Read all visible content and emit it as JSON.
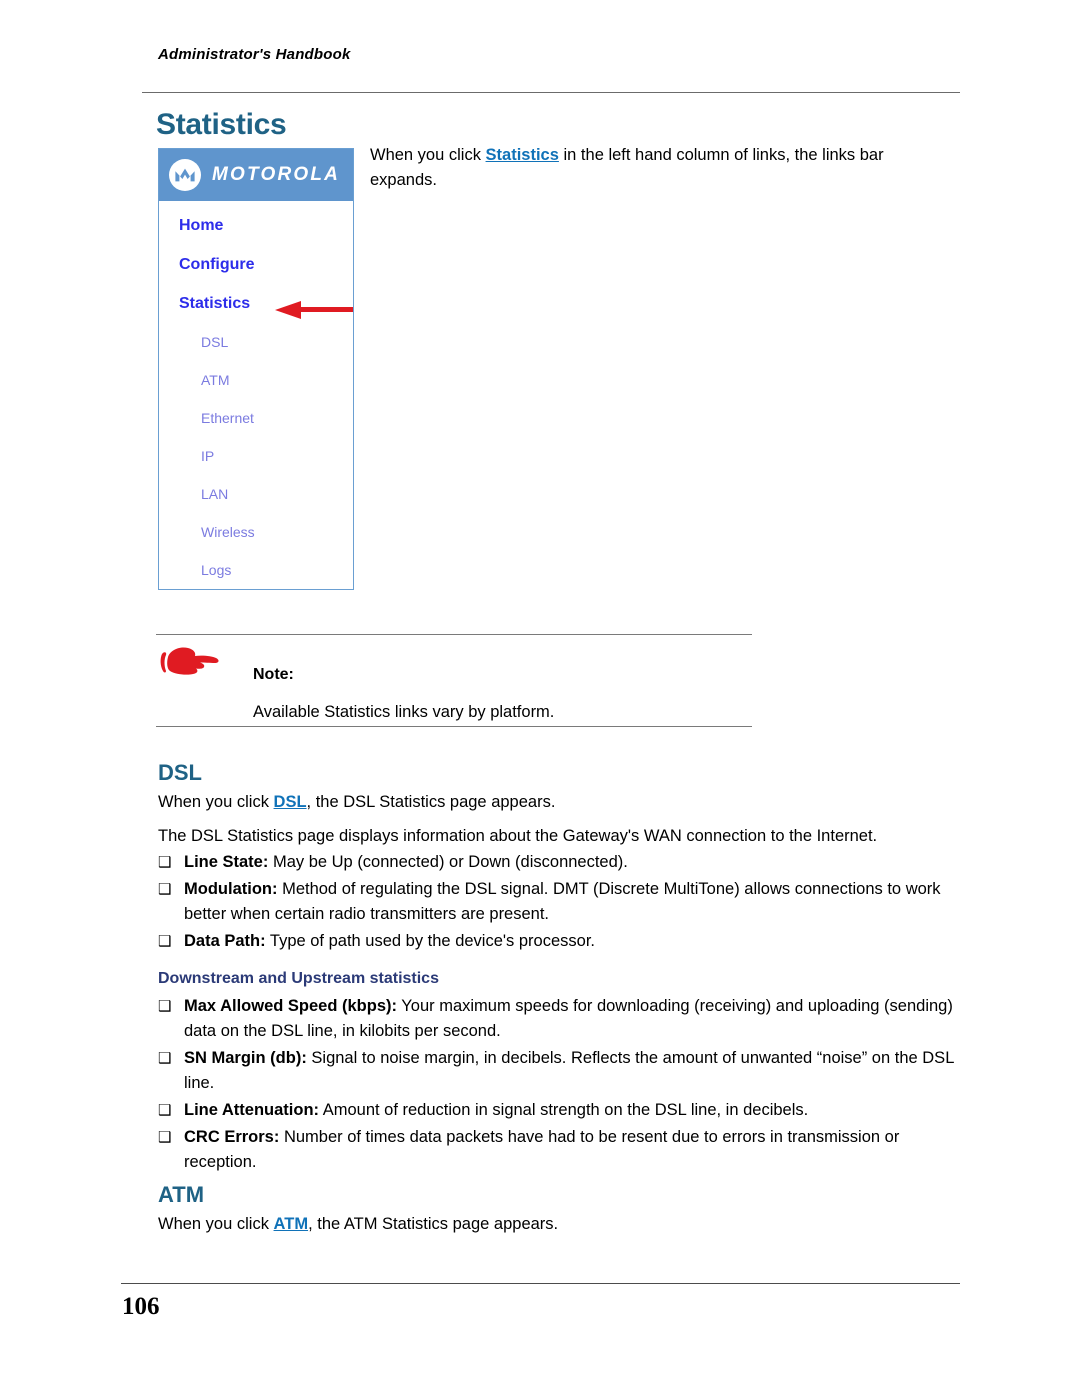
{
  "header": {
    "running_title": "Administrator's Handbook"
  },
  "page_title": "Statistics",
  "intro": {
    "before": "When you click ",
    "link": "Statistics",
    "after": " in the left hand column of links, the links bar expands."
  },
  "nav_panel": {
    "logo": {
      "wordmark": "MOTOROLA",
      "emblem_name": "motorola-batwing-emblem"
    },
    "main_links": [
      {
        "label": "Home"
      },
      {
        "label": "Configure"
      },
      {
        "label": "Statistics"
      }
    ],
    "sub_links": [
      {
        "label": "DSL"
      },
      {
        "label": "ATM"
      },
      {
        "label": "Ethernet"
      },
      {
        "label": "IP"
      },
      {
        "label": "LAN"
      },
      {
        "label": "Wireless"
      },
      {
        "label": "Logs"
      }
    ],
    "annotation_arrow": "red-left-arrow"
  },
  "note": {
    "label": "Note:",
    "text": "Available Statistics links vary by platform.",
    "icon": "pointing-hand-icon"
  },
  "dsl_section": {
    "heading": "DSL",
    "para1_before": "When you click ",
    "para1_link": "DSL",
    "para1_after": ", the DSL Statistics page appears.",
    "para2": "The DSL Statistics page displays information about the Gateway's WAN connection to the Internet.",
    "bullets": [
      {
        "term": "Line State:",
        "desc": " May be Up (connected) or Down (disconnected)."
      },
      {
        "term": "Modulation:",
        "desc": " Method of regulating the DSL signal. DMT (Discrete MultiTone) allows connections to work better when certain radio transmitters are present."
      },
      {
        "term": "Data Path:",
        "desc": " Type of path used by the device's processor."
      }
    ],
    "subheading": "Downstream and Upstream statistics",
    "sub_bullets": [
      {
        "term": "Max Allowed Speed (kbps):",
        "desc": " Your maximum speeds for downloading (receiving) and uploading (sending) data on the DSL line, in kilobits per second."
      },
      {
        "term": "SN Margin (db):",
        "desc": " Signal to noise margin, in decibels. Reflects the amount of unwanted “noise” on the DSL line."
      },
      {
        "term": "Line Attenuation:",
        "desc": " Amount of reduction in signal strength on the DSL line, in decibels."
      },
      {
        "term": "CRC Errors:",
        "desc": " Number of times data packets have had to be resent due to errors in transmission or reception."
      }
    ],
    "bullet_marker": "❑"
  },
  "atm_section": {
    "heading": "ATM",
    "para_before": "When you click ",
    "para_link": "ATM",
    "para_after": ", the ATM Statistics page appears."
  },
  "footer": {
    "page_number": "106"
  },
  "colors": {
    "heading_teal": "#1f6285",
    "subheading_navy": "#2b3a77",
    "link_blue": "#1072b8",
    "nav_main_blue": "#2d2dea",
    "nav_sub_violet": "#7b7be0",
    "logo_bar_blue": "#5f95cd",
    "arrow_red": "#e01b22"
  }
}
